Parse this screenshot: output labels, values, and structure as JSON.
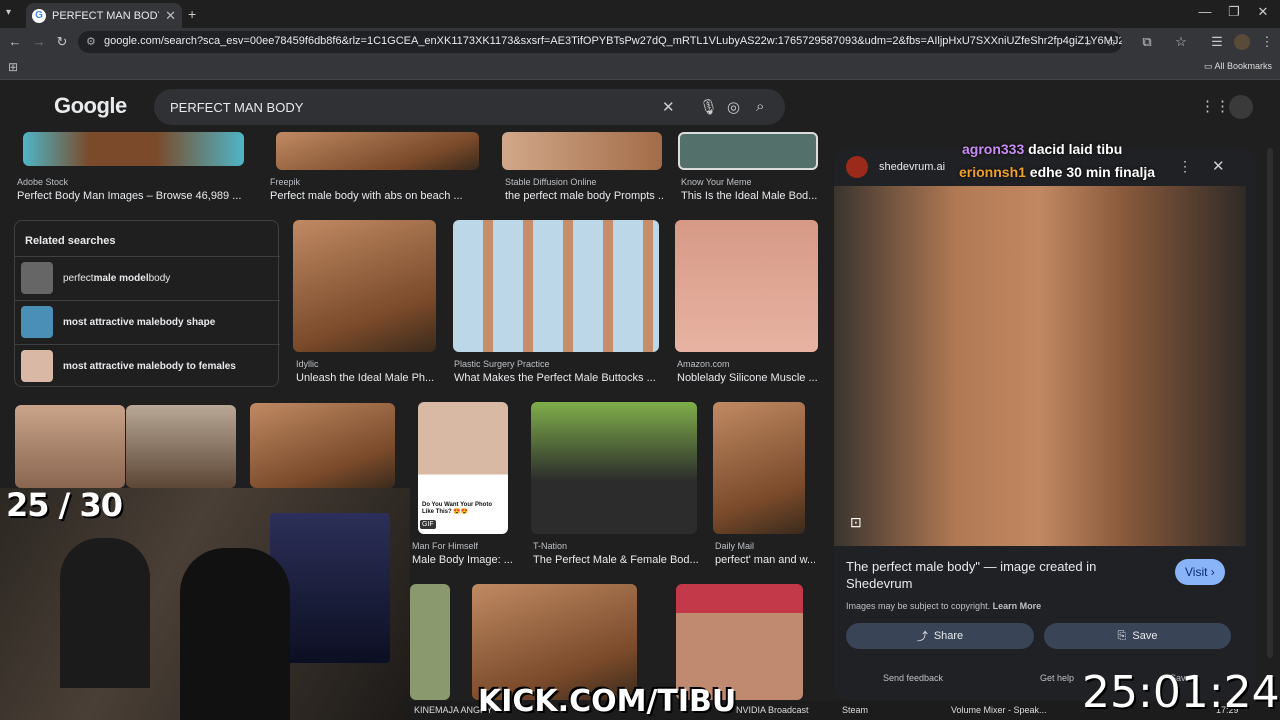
{
  "tab": {
    "title": "PERFECT MAN BODY - Google",
    "close": "✕",
    "new": "+"
  },
  "window": {
    "min": "—",
    "restore": "❐",
    "close": "✕"
  },
  "url": "google.com/search?sca_esv=00ee78459f6db8f6&rlz=1C1GCEA_enXK1173XK1173&sxsrf=AE3TifOPYBTsPw27dQ_mRTL1VLubyAS22w:1765729587093&udm=2&fbs=AIljpHxU7SXXniUZfeShr2fp4giZ1Y6MJ25_tmWITc7uy4KIemkjk18Cn72G...",
  "bookmarks": {
    "all": "All Bookmarks"
  },
  "google": {
    "logo": "Google",
    "query": "PERFECT MAN BODY"
  },
  "top_row": [
    {
      "source": "Adobe Stock",
      "caption": "Perfect Body Man Images – Browse 46,989 ..."
    },
    {
      "source": "Freepik",
      "caption": "Perfect male body with abs on beach ..."
    },
    {
      "source": "Stable Diffusion Online",
      "caption": "the perfect male body Prompts ..."
    },
    {
      "source": "Know Your Meme",
      "caption": "This Is the Ideal Male Bod..."
    }
  ],
  "related": {
    "title": "Related searches",
    "items": [
      {
        "pre": "perfect ",
        "bold": "male model",
        "post": " body"
      },
      {
        "pre": "",
        "bold": "most attractive male",
        "post": " body shape"
      },
      {
        "pre": "",
        "bold": "most attractive male",
        "post": " body to females"
      }
    ]
  },
  "row2": [
    {
      "source": "Idyllic",
      "caption": "Unleash the Ideal Male Ph..."
    },
    {
      "source": "Plastic Surgery Practice",
      "caption": "What Makes the Perfect Male Buttocks ..."
    },
    {
      "source": "Amazon.com",
      "caption": "Noblelady Silicone Muscle ..."
    }
  ],
  "row3": [
    {
      "source": "Man For Himself",
      "caption": "Male Body Image: ...",
      "overlay": "Do You Want Your Photo\nLike This? 😍😍",
      "gif": "GIF"
    },
    {
      "source": "T-Nation",
      "caption": "The Perfect Male & Female Bod..."
    },
    {
      "source": "Daily Mail",
      "caption": "perfect' man and w..."
    }
  ],
  "panel": {
    "site": "shedevrum.ai",
    "title": "The perfect male body\" — image created in Shedevrum",
    "visit": "Visit ›",
    "copyright": "Images may be subject to copyright.",
    "learn": "Learn More",
    "share": "Share",
    "save": "Save",
    "feedback": "Send feedback",
    "help": "Get help",
    "saved": "Saved"
  },
  "chat": [
    {
      "user": "agron333",
      "msg": "dacid laid tibu",
      "color": "#c98cf5"
    },
    {
      "user": "erionnsh1",
      "msg": "edhe 30 min finalja",
      "color": "#f0a028"
    }
  ],
  "stream": {
    "counter": "25 / 30",
    "timer": "25:01:24",
    "kick": "KICK.COM/TIBU"
  },
  "taskbar": {
    "items": [
      "KINEMAJA ANGRY",
      "NVIDIA Broadcast",
      "Steam",
      "Volume Mixer - Speak..."
    ],
    "time": "17:29"
  }
}
